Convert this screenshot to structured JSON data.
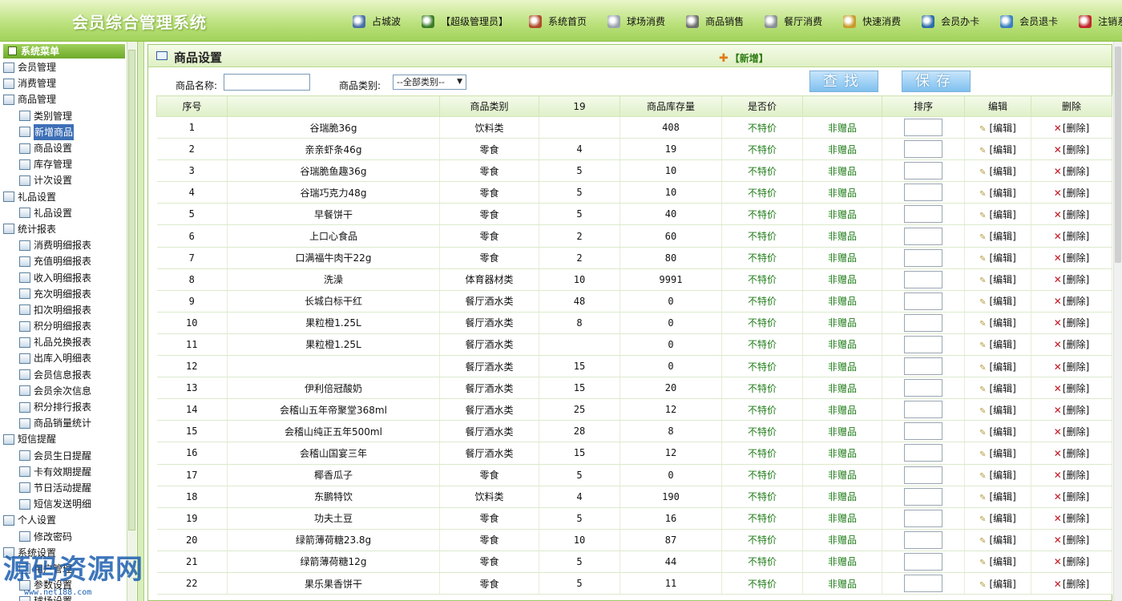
{
  "app": {
    "title": "会员综合管理系统"
  },
  "topnav": [
    {
      "label": "占城波",
      "icon": "user-icon"
    },
    {
      "label": "【超级管理员】",
      "icon": "admin-icon"
    },
    {
      "label": "系统首页",
      "icon": "home-icon"
    },
    {
      "label": "球场消费",
      "icon": "ball-icon"
    },
    {
      "label": "商品销售",
      "icon": "goods-icon"
    },
    {
      "label": "餐厅消费",
      "icon": "restaurant-icon"
    },
    {
      "label": "快速消费",
      "icon": "quick-pay-icon"
    },
    {
      "label": "会员办卡",
      "icon": "member-card-icon"
    },
    {
      "label": "会员退卡",
      "icon": "refund-card-icon"
    },
    {
      "label": "注销系统",
      "icon": "logout-icon"
    }
  ],
  "sidebar": {
    "title": "系统菜单",
    "items": [
      {
        "label": "会员管理",
        "level": 0
      },
      {
        "label": "消费管理",
        "level": 0
      },
      {
        "label": "商品管理",
        "level": 0
      },
      {
        "label": "类别管理",
        "level": 1
      },
      {
        "label": "新增商品",
        "level": 1,
        "selected": true
      },
      {
        "label": "商品设置",
        "level": 1
      },
      {
        "label": "库存管理",
        "level": 1
      },
      {
        "label": "计次设置",
        "level": 1
      },
      {
        "label": "礼品设置",
        "level": 0
      },
      {
        "label": "礼品设置",
        "level": 1
      },
      {
        "label": "统计报表",
        "level": 0
      },
      {
        "label": "消费明细报表",
        "level": 1
      },
      {
        "label": "充值明细报表",
        "level": 1
      },
      {
        "label": "收入明细报表",
        "level": 1
      },
      {
        "label": "充次明细报表",
        "level": 1
      },
      {
        "label": "扣次明细报表",
        "level": 1
      },
      {
        "label": "积分明细报表",
        "level": 1
      },
      {
        "label": "礼品兑换报表",
        "level": 1
      },
      {
        "label": "出库入明细表",
        "level": 1
      },
      {
        "label": "会员信息报表",
        "level": 1
      },
      {
        "label": "会员余次信息",
        "level": 1
      },
      {
        "label": "积分排行报表",
        "level": 1
      },
      {
        "label": "商品销量统计",
        "level": 1
      },
      {
        "label": "短信提醒",
        "level": 0
      },
      {
        "label": "会员生日提醒",
        "level": 1
      },
      {
        "label": "卡有效期提醒",
        "level": 1
      },
      {
        "label": "节日活动提醒",
        "level": 1
      },
      {
        "label": "短信发送明细",
        "level": 1
      },
      {
        "label": "个人设置",
        "level": 0
      },
      {
        "label": "修改密码",
        "level": 1
      },
      {
        "label": "系统设置",
        "level": 0
      },
      {
        "label": "用户管理",
        "level": 1
      },
      {
        "label": "参数设置",
        "level": 1
      },
      {
        "label": "球场设置",
        "level": 1
      }
    ]
  },
  "panel": {
    "title": "商品设置",
    "add_label": "【新增】",
    "search": {
      "name_label": "商品名称:",
      "name_value": "",
      "category_label": "商品类别:",
      "category_value": "--全部类别--",
      "find_label": "查找",
      "save_label": "保存"
    }
  },
  "table": {
    "columns": [
      "序号",
      "",
      "商品类别",
      "19",
      "商品库存量",
      "是否价",
      "",
      "排序",
      "编辑",
      "删除"
    ],
    "edit_label": "[编辑]",
    "delete_label": "[删除]",
    "rows": [
      [
        "1",
        "谷瑞脆36g",
        "饮料类",
        "",
        "408",
        "不特价",
        "非赠品"
      ],
      [
        "2",
        "亲亲虾条46g",
        "零食",
        "4",
        "19",
        "不特价",
        "非赠品"
      ],
      [
        "3",
        "谷瑞脆鱼趣36g",
        "零食",
        "5",
        "10",
        "不特价",
        "非赠品"
      ],
      [
        "4",
        "谷瑞巧克力48g",
        "零食",
        "5",
        "10",
        "不特价",
        "非赠品"
      ],
      [
        "5",
        "早餐饼干",
        "零食",
        "5",
        "40",
        "不特价",
        "非赠品"
      ],
      [
        "6",
        "上口心食品",
        "零食",
        "2",
        "60",
        "不特价",
        "非赠品"
      ],
      [
        "7",
        "口满福牛肉干22g",
        "零食",
        "2",
        "80",
        "不特价",
        "非赠品"
      ],
      [
        "8",
        "洗澡",
        "体育器材类",
        "10",
        "9991",
        "不特价",
        "非赠品"
      ],
      [
        "9",
        "长城白标干红",
        "餐厅酒水类",
        "48",
        "0",
        "不特价",
        "非赠品"
      ],
      [
        "10",
        "果粒橙1.25L",
        "餐厅酒水类",
        "8",
        "0",
        "不特价",
        "非赠品"
      ],
      [
        "11",
        "果粒橙1.25L",
        "餐厅酒水类",
        "",
        "0",
        "不特价",
        "非赠品"
      ],
      [
        "12",
        "",
        "餐厅酒水类",
        "15",
        "0",
        "不特价",
        "非赠品"
      ],
      [
        "13",
        "伊利倍冠酸奶",
        "餐厅酒水类",
        "15",
        "20",
        "不特价",
        "非赠品"
      ],
      [
        "14",
        "会稽山五年帝聚堂368ml",
        "餐厅酒水类",
        "25",
        "12",
        "不特价",
        "非赠品"
      ],
      [
        "15",
        "会稽山纯正五年500ml",
        "餐厅酒水类",
        "28",
        "8",
        "不特价",
        "非赠品"
      ],
      [
        "16",
        "会稽山国宴三年",
        "餐厅酒水类",
        "15",
        "12",
        "不特价",
        "非赠品"
      ],
      [
        "17",
        "椰香瓜子",
        "零食",
        "5",
        "0",
        "不特价",
        "非赠品"
      ],
      [
        "18",
        "东鹏特饮",
        "饮料类",
        "4",
        "190",
        "不特价",
        "非赠品"
      ],
      [
        "19",
        "功夫土豆",
        "零食",
        "5",
        "16",
        "不特价",
        "非赠品"
      ],
      [
        "20",
        "绿箭薄荷糖23.8g",
        "零食",
        "10",
        "87",
        "不特价",
        "非赠品"
      ],
      [
        "21",
        "绿箭薄荷糖12g",
        "零食",
        "5",
        "44",
        "不特价",
        "非赠品"
      ],
      [
        "22",
        "果乐果香饼干",
        "零食",
        "5",
        "11",
        "不特价",
        "非赠品"
      ]
    ]
  },
  "watermark": {
    "text": "源码资源网",
    "url": "www.net188.com"
  },
  "colors": {
    "header_green": "#a2d25b",
    "text_green": "#1f7d18",
    "delete_red": "#c5151f",
    "button_blue": "#7fc0ef"
  }
}
